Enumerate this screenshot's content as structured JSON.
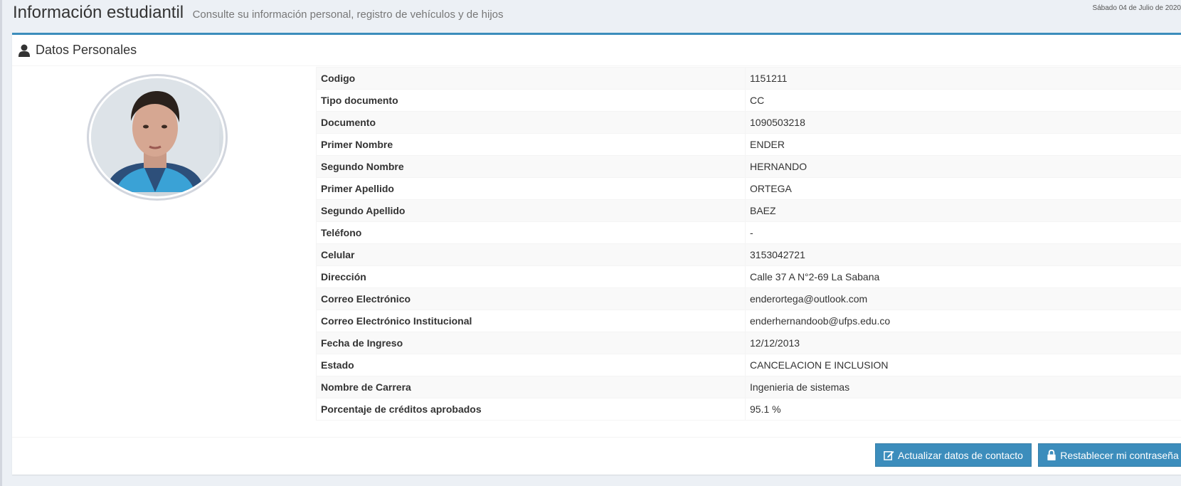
{
  "header": {
    "title": "Información estudiantil",
    "subtitle": "Consulte su información personal, registro de vehículos y de hijos",
    "date": "Sábado 04 de Julio de 2020"
  },
  "box": {
    "title": "Datos Personales",
    "icon": "user-icon"
  },
  "rows": [
    {
      "label": "Codigo",
      "value": "1151211"
    },
    {
      "label": "Tipo documento",
      "value": "CC"
    },
    {
      "label": "Documento",
      "value": "1090503218"
    },
    {
      "label": "Primer Nombre",
      "value": "ENDER"
    },
    {
      "label": "Segundo Nombre",
      "value": "HERNANDO"
    },
    {
      "label": "Primer Apellido",
      "value": "ORTEGA"
    },
    {
      "label": "Segundo Apellido",
      "value": "BAEZ"
    },
    {
      "label": "Teléfono",
      "value": "-"
    },
    {
      "label": "Celular",
      "value": "3153042721"
    },
    {
      "label": "Dirección",
      "value": "Calle 37 A N°2-69 La Sabana"
    },
    {
      "label": "Correo Electrónico",
      "value": "enderortega@outlook.com"
    },
    {
      "label": "Correo Electrónico Institucional",
      "value": "enderhernandoob@ufps.edu.co"
    },
    {
      "label": "Fecha de Ingreso",
      "value": "12/12/2013"
    },
    {
      "label": "Estado",
      "value": "CANCELACION E INCLUSION"
    },
    {
      "label": "Nombre de Carrera",
      "value": "Ingenieria de sistemas"
    },
    {
      "label": "Porcentaje de créditos aprobados",
      "value": "95.1 %"
    }
  ],
  "buttons": {
    "update_label": "Actualizar datos de contacto",
    "reset_label": "Restablecer mi contraseña"
  },
  "colors": {
    "accent": "#3c8dbc",
    "background": "#ecf0f5"
  }
}
